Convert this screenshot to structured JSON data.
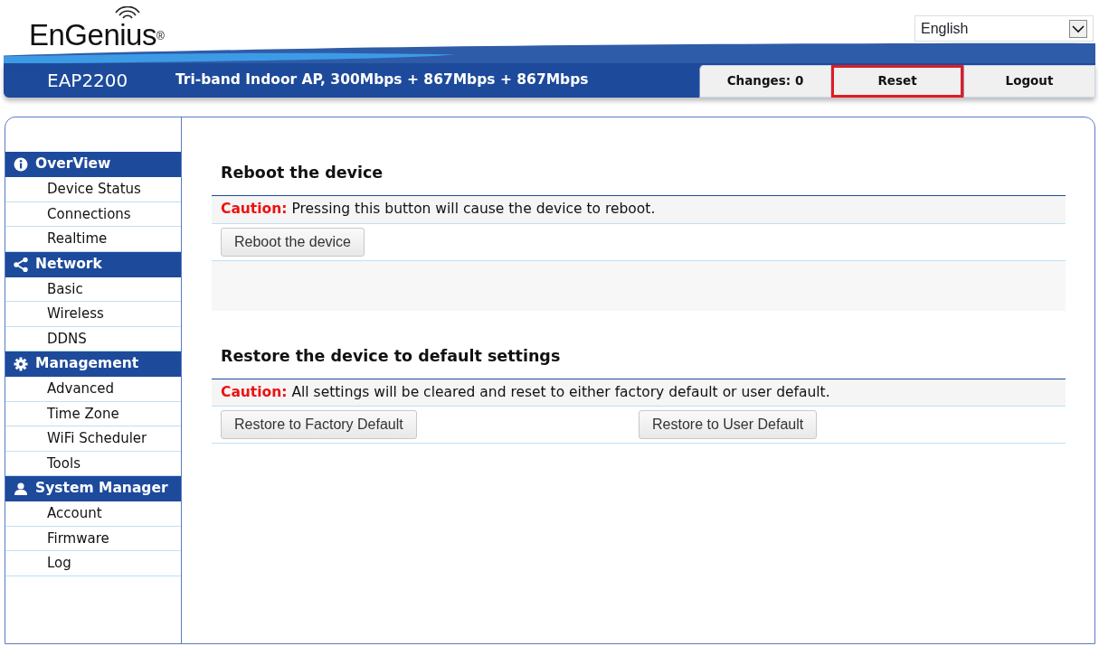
{
  "header": {
    "logo": "EnGenius",
    "logo_mark": "®",
    "language": "English",
    "model": "EAP2200",
    "description": "Tri-band Indoor AP, 300Mbps + 867Mbps + 867Mbps",
    "actions": [
      {
        "label": "Changes: 0",
        "highlighted": false
      },
      {
        "label": "Reset",
        "highlighted": true
      },
      {
        "label": "Logout",
        "highlighted": false
      }
    ]
  },
  "sidebar": {
    "groups": [
      {
        "title": "OverView",
        "kind": "info",
        "items": [
          "Device Status",
          "Connections",
          "Realtime"
        ]
      },
      {
        "title": "Network",
        "kind": "share",
        "items": [
          "Basic",
          "Wireless",
          "DDNS"
        ]
      },
      {
        "title": "Management",
        "kind": "settings",
        "items": [
          "Advanced",
          "Time Zone",
          "WiFi Scheduler",
          "Tools"
        ]
      },
      {
        "title": "System Manager",
        "kind": "user",
        "items": [
          "Account",
          "Firmware",
          "Log"
        ]
      }
    ]
  },
  "sections": [
    {
      "title": "Reboot the device",
      "caution": "**Caution:** Pressing this button will cause the device to reboot.",
      "buttons": [
        "Reboot the device"
      ],
      "spacer": true
    },
    {
      "title": "Restore the device to default settings",
      "caution": "**Caution:** All settings will be cleared and reset to either factory default or user default.",
      "buttons": [
        "Restore to Factory Default",
        "Restore to User Default"
      ]
    }
  ]
}
